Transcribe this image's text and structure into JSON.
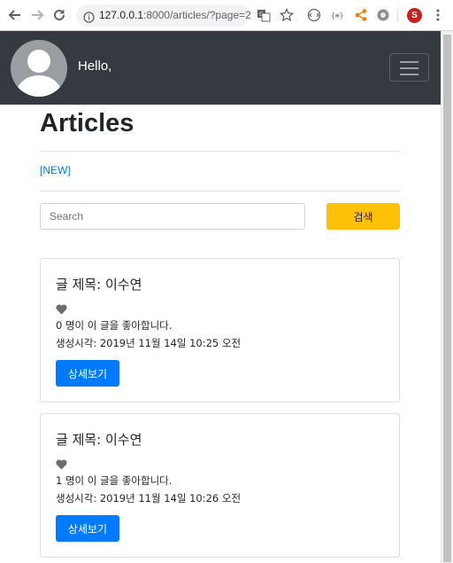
{
  "browser": {
    "url_host": "127.0.0.1",
    "url_rest": ":8000/articles/?page=2",
    "profile_initial": "S",
    "icons": [
      "back-icon",
      "forward-icon",
      "reload-icon",
      "info-icon",
      "translate-icon",
      "star-icon",
      "extension-icon",
      "json-icon",
      "share-icon",
      "settings-icon",
      "menu-icon"
    ]
  },
  "navbar": {
    "greeting": "Hello,",
    "background": "#343a40"
  },
  "main": {
    "heading": "Articles",
    "new_link": "[NEW]",
    "search_placeholder": "Search",
    "search_button": "검색"
  },
  "articles": [
    {
      "title": "글 제목: 이수연",
      "likes": "0 명이 이 글을 좋아합니다.",
      "created": "생성시각: 2019년 11월 14일 10:25 오전",
      "button": "상세보기"
    },
    {
      "title": "글 제목: 이수연",
      "likes": "1 명이 이 글을 좋아합니다.",
      "created": "생성시각: 2019년 11월 14일 10:26 오전",
      "button": "상세보기"
    }
  ],
  "colors": {
    "primary": "#007bff",
    "warning": "#ffc107",
    "heart": "#6c6c6c"
  }
}
